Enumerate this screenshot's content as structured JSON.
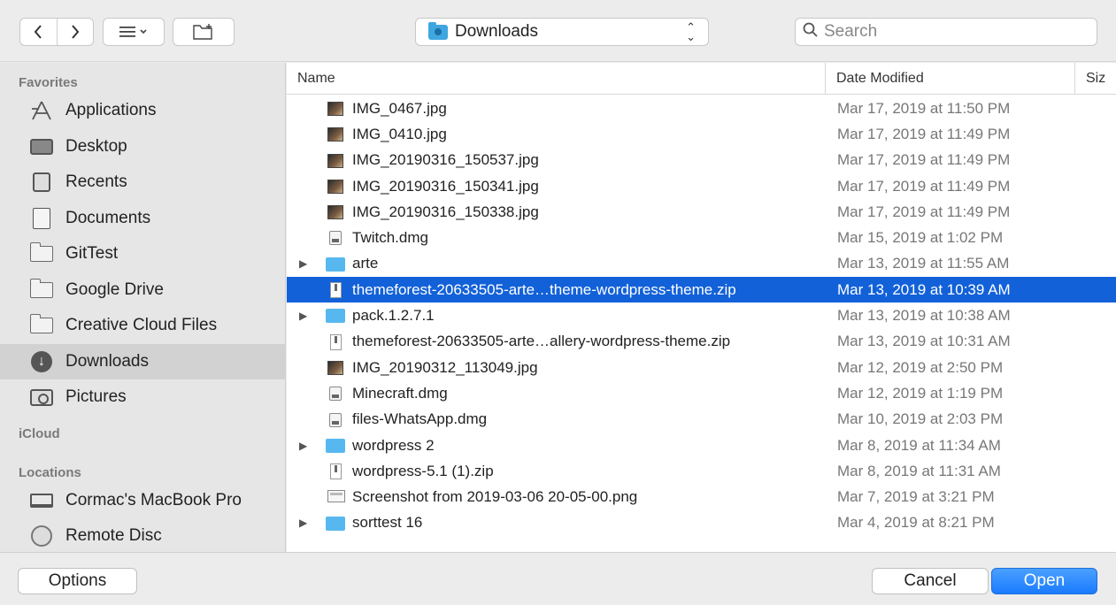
{
  "toolbar": {
    "back_icon": "chevron-left-icon",
    "forward_icon": "chevron-right-icon",
    "view_icon": "list-view-icon",
    "new_folder_icon": "new-folder-icon",
    "location": "Downloads",
    "search_placeholder": "Search"
  },
  "sidebar": {
    "favorites_title": "Favorites",
    "favorites": [
      {
        "label": "Applications",
        "icon": "applications-icon"
      },
      {
        "label": "Desktop",
        "icon": "desktop-icon"
      },
      {
        "label": "Recents",
        "icon": "recents-icon"
      },
      {
        "label": "Documents",
        "icon": "documents-icon"
      },
      {
        "label": "GitTest",
        "icon": "folder-icon"
      },
      {
        "label": "Google Drive",
        "icon": "folder-icon"
      },
      {
        "label": "Creative Cloud Files",
        "icon": "folder-icon"
      },
      {
        "label": "Downloads",
        "icon": "downloads-icon",
        "active": true
      },
      {
        "label": "Pictures",
        "icon": "camera-icon"
      }
    ],
    "icloud_title": "iCloud",
    "locations_title": "Locations",
    "locations": [
      {
        "label": "Cormac's MacBook Pro",
        "icon": "laptop-icon"
      },
      {
        "label": "Remote Disc",
        "icon": "disc-icon"
      }
    ]
  },
  "list": {
    "columns": {
      "name": "Name",
      "date": "Date Modified",
      "size": "Siz"
    },
    "rows": [
      {
        "name": "IMG_0467.jpg",
        "date": "Mar 17, 2019 at 11:50 PM",
        "type": "img",
        "folder": false
      },
      {
        "name": "IMG_0410.jpg",
        "date": "Mar 17, 2019 at 11:49 PM",
        "type": "img",
        "folder": false
      },
      {
        "name": "IMG_20190316_150537.jpg",
        "date": "Mar 17, 2019 at 11:49 PM",
        "type": "img",
        "folder": false
      },
      {
        "name": "IMG_20190316_150341.jpg",
        "date": "Mar 17, 2019 at 11:49 PM",
        "type": "img",
        "folder": false
      },
      {
        "name": "IMG_20190316_150338.jpg",
        "date": "Mar 17, 2019 at 11:49 PM",
        "type": "img",
        "folder": false
      },
      {
        "name": "Twitch.dmg",
        "date": "Mar 15, 2019 at 1:02 PM",
        "type": "dmg",
        "folder": false
      },
      {
        "name": "arte",
        "date": "Mar 13, 2019 at 11:55 AM",
        "type": "folder",
        "folder": true
      },
      {
        "name": "themeforest-20633505-arte…theme-wordpress-theme.zip",
        "date": "Mar 13, 2019 at 10:39 AM",
        "type": "zip",
        "folder": false,
        "selected": true
      },
      {
        "name": "pack.1.2.7.1",
        "date": "Mar 13, 2019 at 10:38 AM",
        "type": "folder",
        "folder": true
      },
      {
        "name": "themeforest-20633505-arte…allery-wordpress-theme.zip",
        "date": "Mar 13, 2019 at 10:31 AM",
        "type": "zip",
        "folder": false
      },
      {
        "name": "IMG_20190312_113049.jpg",
        "date": "Mar 12, 2019 at 2:50 PM",
        "type": "img",
        "folder": false
      },
      {
        "name": "Minecraft.dmg",
        "date": "Mar 12, 2019 at 1:19 PM",
        "type": "dmg",
        "folder": false
      },
      {
        "name": "files-WhatsApp.dmg",
        "date": "Mar 10, 2019 at 2:03 PM",
        "type": "dmg",
        "folder": false
      },
      {
        "name": "wordpress 2",
        "date": "Mar 8, 2019 at 11:34 AM",
        "type": "folder",
        "folder": true
      },
      {
        "name": "wordpress-5.1 (1).zip",
        "date": "Mar 8, 2019 at 11:31 AM",
        "type": "zip",
        "folder": false
      },
      {
        "name": "Screenshot from 2019-03-06 20-05-00.png",
        "date": "Mar 7, 2019 at 3:21 PM",
        "type": "png",
        "folder": false
      },
      {
        "name": "sorttest 16",
        "date": "Mar 4, 2019 at 8:21 PM",
        "type": "folder",
        "folder": true
      }
    ]
  },
  "buttons": {
    "options": "Options",
    "cancel": "Cancel",
    "open": "Open"
  },
  "colors": {
    "selection": "#1261d9",
    "primary_button": "#1a7bff"
  }
}
